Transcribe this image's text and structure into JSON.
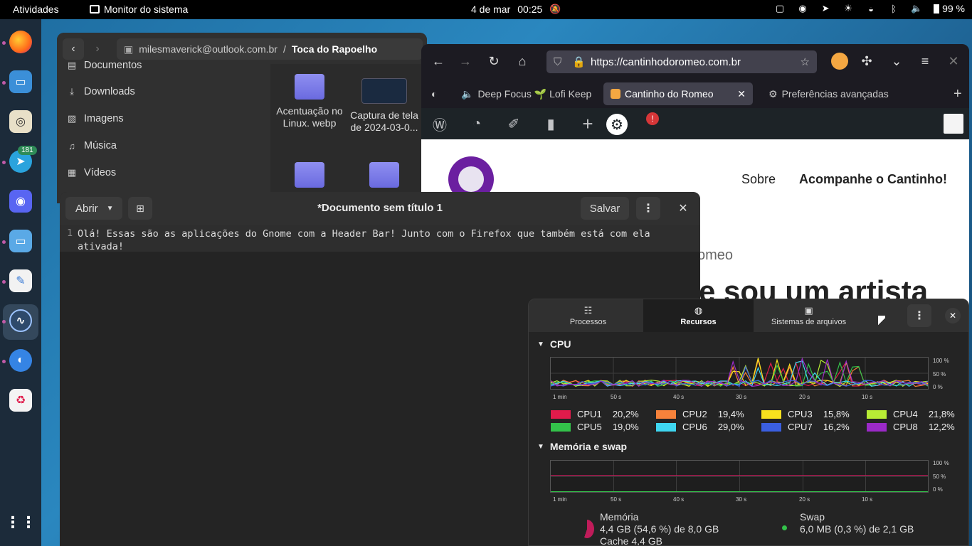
{
  "topbar": {
    "activities": "Atividades",
    "app_name": "Monitor do sistema",
    "date": "4 de mar",
    "time": "00:25",
    "battery": "99 %",
    "icons": [
      "clipboard-icon",
      "discord-icon",
      "telegram-icon",
      "brightness-icon",
      "wifi-icon",
      "bluetooth-icon",
      "volume-icon",
      "battery-icon",
      "dnd-off-icon"
    ]
  },
  "dock": {
    "items": [
      "firefox",
      "files",
      "rhythmbox",
      "telegram",
      "discord",
      "files-alt",
      "text-editor",
      "system-monitor",
      "settings-toggle",
      "trash",
      "app-grid"
    ],
    "telegram_badge": "181"
  },
  "nautilus": {
    "path_account": "milesmaverick@outlook.com.br",
    "path_sep": "/",
    "path_folder": "Toca do Rapoelho",
    "sidebar": [
      {
        "label": "Documentos",
        "icon": "document-icon"
      },
      {
        "label": "Downloads",
        "icon": "download-icon"
      },
      {
        "label": "Imagens",
        "icon": "image-icon"
      },
      {
        "label": "Música",
        "icon": "music-icon"
      },
      {
        "label": "Vídeos",
        "icon": "video-icon"
      }
    ],
    "files": [
      {
        "name": "Acentuação no Linux. webp"
      },
      {
        "name": "Captura de tela de 2024-03-0..."
      }
    ]
  },
  "firefox": {
    "url": "https://cantinhodoromeo.com.br",
    "tabs": [
      {
        "label": "Deep Focus 🌱 Lofi Keep"
      },
      {
        "label": "Cantinho do Romeo"
      },
      {
        "label": "Preferências avançadas"
      }
    ],
    "page": {
      "nav": [
        "Sobre",
        "Acompanhe o Cantinho!"
      ],
      "subtitle": "omeo",
      "title": "e sou um artista"
    }
  },
  "editor": {
    "open_label": "Abrir",
    "title": "*Documento sem título 1",
    "save_label": "Salvar",
    "line_number": "1",
    "text": "Olá! Essas são as aplicações do Gnome com a Header Bar! Junto com o Firefox que também está com ela ativada!"
  },
  "sysmon": {
    "tabs": [
      {
        "label": "Processos",
        "icon": "list-icon"
      },
      {
        "label": "Recursos",
        "icon": "gauge-icon"
      },
      {
        "label": "Sistemas de arquivos",
        "icon": "disk-icon"
      }
    ],
    "cpu_title": "CPU",
    "mem_title": "Memória e swap",
    "y_ticks": [
      "100 %",
      "50 %",
      "0 %"
    ],
    "x_ticks": [
      "1 min",
      "50 s",
      "40 s",
      "30 s",
      "20 s",
      "10 s"
    ],
    "cpus": [
      {
        "name": "CPU1",
        "pct": "20,2%",
        "color": "#e01b4b"
      },
      {
        "name": "CPU2",
        "pct": "19,4%",
        "color": "#f6823b"
      },
      {
        "name": "CPU3",
        "pct": "15,8%",
        "color": "#f8e11e"
      },
      {
        "name": "CPU4",
        "pct": "21,8%",
        "color": "#b8ec35"
      },
      {
        "name": "CPU5",
        "pct": "19,0%",
        "color": "#33c24a"
      },
      {
        "name": "CPU6",
        "pct": "29,0%",
        "color": "#3fd6f0"
      },
      {
        "name": "CPU7",
        "pct": "16,2%",
        "color": "#3b5fe0"
      },
      {
        "name": "CPU8",
        "pct": "12,2%",
        "color": "#9b2ac8"
      }
    ],
    "memory": {
      "label": "Memória",
      "usage": "4,4 GB (54,6 %) de 8,0 GB",
      "cache": "Cache 4,4 GB",
      "color": "#c01c5a",
      "fraction": 0.546
    },
    "swap": {
      "label": "Swap",
      "usage": "6,0 MB (0,3 %) de 2,1 GB",
      "color": "#33c24a",
      "fraction": 0.003
    }
  }
}
